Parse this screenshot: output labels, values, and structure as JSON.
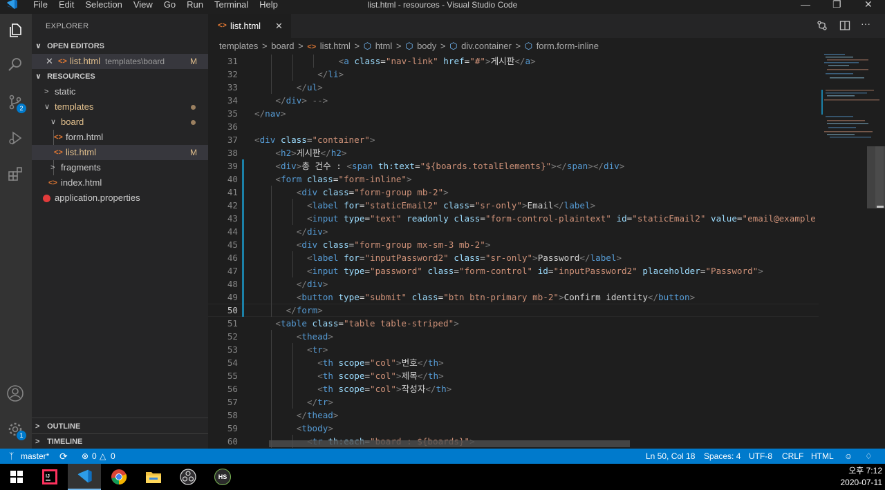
{
  "window": {
    "title": "list.html - resources - Visual Studio Code",
    "menu": [
      "File",
      "Edit",
      "Selection",
      "View",
      "Go",
      "Run",
      "Terminal",
      "Help"
    ]
  },
  "activity": {
    "source_control_badge": "2",
    "settings_badge": "1"
  },
  "sidebar": {
    "title": "EXPLORER",
    "open_editors_label": "OPEN EDITORS",
    "open_editor": {
      "name": "list.html",
      "path": "templates\\board",
      "status": "M"
    },
    "resources_label": "RESOURCES",
    "tree": [
      {
        "label": "static",
        "kind": "folder",
        "expanded": false
      },
      {
        "label": "templates",
        "kind": "folder",
        "expanded": true
      },
      {
        "label": "board",
        "kind": "folder",
        "expanded": true
      },
      {
        "label": "form.html",
        "kind": "html"
      },
      {
        "label": "list.html",
        "kind": "html",
        "status": "M"
      },
      {
        "label": "fragments",
        "kind": "folder",
        "expanded": false
      },
      {
        "label": "index.html",
        "kind": "html"
      },
      {
        "label": "application.properties",
        "kind": "properties"
      }
    ],
    "outline_label": "OUTLINE",
    "timeline_label": "TIMELINE"
  },
  "tab": {
    "label": "list.html"
  },
  "breadcrumb": [
    "templates",
    "board",
    "list.html",
    "html",
    "body",
    "div.container",
    "form.form-inline"
  ],
  "editor": {
    "lines": [
      {
        "n": "31",
        "indent": 16,
        "tokens": [
          [
            "p",
            "<"
          ],
          [
            "t",
            "a "
          ],
          [
            "a",
            "class"
          ],
          [
            "x",
            "="
          ],
          [
            "s",
            "\"nav-link\""
          ],
          [
            "x",
            " "
          ],
          [
            "a",
            "href"
          ],
          [
            "x",
            "="
          ],
          [
            "s",
            "\"#\""
          ],
          [
            "p",
            ">"
          ],
          [
            "x",
            "게시판"
          ],
          [
            "p",
            "</"
          ],
          [
            "t",
            "a"
          ],
          [
            "p",
            ">"
          ]
        ]
      },
      {
        "n": "32",
        "indent": 12,
        "tokens": [
          [
            "p",
            "</"
          ],
          [
            "t",
            "li"
          ],
          [
            "p",
            ">"
          ]
        ]
      },
      {
        "n": "33",
        "indent": 8,
        "tokens": [
          [
            "p",
            "</"
          ],
          [
            "t",
            "ul"
          ],
          [
            "p",
            ">"
          ]
        ]
      },
      {
        "n": "34",
        "indent": 4,
        "tokens": [
          [
            "p",
            "</"
          ],
          [
            "t",
            "div"
          ],
          [
            "p",
            ">"
          ],
          [
            "x",
            " "
          ],
          [
            "p",
            "-->"
          ]
        ]
      },
      {
        "n": "35",
        "indent": 0,
        "tokens": [
          [
            "p",
            "</"
          ],
          [
            "t",
            "nav"
          ],
          [
            "p",
            ">"
          ]
        ]
      },
      {
        "n": "36",
        "indent": 0,
        "tokens": []
      },
      {
        "n": "37",
        "indent": 0,
        "tokens": [
          [
            "p",
            "<"
          ],
          [
            "t",
            "div "
          ],
          [
            "a",
            "class"
          ],
          [
            "x",
            "="
          ],
          [
            "s",
            "\"container\""
          ],
          [
            "p",
            ">"
          ]
        ]
      },
      {
        "n": "38",
        "indent": 4,
        "tokens": [
          [
            "p",
            "<"
          ],
          [
            "t",
            "h2"
          ],
          [
            "p",
            ">"
          ],
          [
            "x",
            "게시판"
          ],
          [
            "p",
            "</"
          ],
          [
            "t",
            "h2"
          ],
          [
            "p",
            ">"
          ]
        ]
      },
      {
        "n": "39",
        "indent": 4,
        "mod": true,
        "tokens": [
          [
            "p",
            "<"
          ],
          [
            "t",
            "div"
          ],
          [
            "p",
            ">"
          ],
          [
            "x",
            "총 건수 : "
          ],
          [
            "p",
            "<"
          ],
          [
            "t",
            "span "
          ],
          [
            "a",
            "th:text"
          ],
          [
            "x",
            "="
          ],
          [
            "s",
            "\"${boards.totalElements}\""
          ],
          [
            "p",
            "></"
          ],
          [
            "t",
            "span"
          ],
          [
            "p",
            "></"
          ],
          [
            "t",
            "div"
          ],
          [
            "p",
            ">"
          ]
        ]
      },
      {
        "n": "40",
        "indent": 4,
        "mod": true,
        "tokens": [
          [
            "p",
            "<"
          ],
          [
            "t",
            "form "
          ],
          [
            "a",
            "class"
          ],
          [
            "x",
            "="
          ],
          [
            "s",
            "\"form-inline\""
          ],
          [
            "p",
            ">"
          ]
        ]
      },
      {
        "n": "41",
        "indent": 8,
        "mod": true,
        "tokens": [
          [
            "p",
            "<"
          ],
          [
            "t",
            "div "
          ],
          [
            "a",
            "class"
          ],
          [
            "x",
            "="
          ],
          [
            "s",
            "\"form-group mb-2\""
          ],
          [
            "p",
            ">"
          ]
        ]
      },
      {
        "n": "42",
        "indent": 10,
        "mod": true,
        "tokens": [
          [
            "p",
            "<"
          ],
          [
            "t",
            "label "
          ],
          [
            "a",
            "for"
          ],
          [
            "x",
            "="
          ],
          [
            "s",
            "\"staticEmail2\""
          ],
          [
            "x",
            " "
          ],
          [
            "a",
            "class"
          ],
          [
            "x",
            "="
          ],
          [
            "s",
            "\"sr-only\""
          ],
          [
            "p",
            ">"
          ],
          [
            "x",
            "Email"
          ],
          [
            "p",
            "</"
          ],
          [
            "t",
            "label"
          ],
          [
            "p",
            ">"
          ]
        ]
      },
      {
        "n": "43",
        "indent": 10,
        "mod": true,
        "tokens": [
          [
            "p",
            "<"
          ],
          [
            "t",
            "input "
          ],
          [
            "a",
            "type"
          ],
          [
            "x",
            "="
          ],
          [
            "s",
            "\"text\""
          ],
          [
            "x",
            " "
          ],
          [
            "a",
            "readonly"
          ],
          [
            "x",
            " "
          ],
          [
            "a",
            "class"
          ],
          [
            "x",
            "="
          ],
          [
            "s",
            "\"form-control-plaintext\""
          ],
          [
            "x",
            " "
          ],
          [
            "a",
            "id"
          ],
          [
            "x",
            "="
          ],
          [
            "s",
            "\"staticEmail2\""
          ],
          [
            "x",
            " "
          ],
          [
            "a",
            "value"
          ],
          [
            "x",
            "="
          ],
          [
            "s",
            "\"email@example"
          ]
        ]
      },
      {
        "n": "44",
        "indent": 8,
        "mod": true,
        "tokens": [
          [
            "p",
            "</"
          ],
          [
            "t",
            "div"
          ],
          [
            "p",
            ">"
          ]
        ]
      },
      {
        "n": "45",
        "indent": 8,
        "mod": true,
        "tokens": [
          [
            "p",
            "<"
          ],
          [
            "t",
            "div "
          ],
          [
            "a",
            "class"
          ],
          [
            "x",
            "="
          ],
          [
            "s",
            "\"form-group mx-sm-3 mb-2\""
          ],
          [
            "p",
            ">"
          ]
        ]
      },
      {
        "n": "46",
        "indent": 10,
        "mod": true,
        "tokens": [
          [
            "p",
            "<"
          ],
          [
            "t",
            "label "
          ],
          [
            "a",
            "for"
          ],
          [
            "x",
            "="
          ],
          [
            "s",
            "\"inputPassword2\""
          ],
          [
            "x",
            " "
          ],
          [
            "a",
            "class"
          ],
          [
            "x",
            "="
          ],
          [
            "s",
            "\"sr-only\""
          ],
          [
            "p",
            ">"
          ],
          [
            "x",
            "Password"
          ],
          [
            "p",
            "</"
          ],
          [
            "t",
            "label"
          ],
          [
            "p",
            ">"
          ]
        ]
      },
      {
        "n": "47",
        "indent": 10,
        "mod": true,
        "tokens": [
          [
            "p",
            "<"
          ],
          [
            "t",
            "input "
          ],
          [
            "a",
            "type"
          ],
          [
            "x",
            "="
          ],
          [
            "s",
            "\"password\""
          ],
          [
            "x",
            " "
          ],
          [
            "a",
            "class"
          ],
          [
            "x",
            "="
          ],
          [
            "s",
            "\"form-control\""
          ],
          [
            "x",
            " "
          ],
          [
            "a",
            "id"
          ],
          [
            "x",
            "="
          ],
          [
            "s",
            "\"inputPassword2\""
          ],
          [
            "x",
            " "
          ],
          [
            "a",
            "placeholder"
          ],
          [
            "x",
            "="
          ],
          [
            "s",
            "\"Password\""
          ],
          [
            "p",
            ">"
          ]
        ]
      },
      {
        "n": "48",
        "indent": 8,
        "mod": true,
        "tokens": [
          [
            "p",
            "</"
          ],
          [
            "t",
            "div"
          ],
          [
            "p",
            ">"
          ]
        ]
      },
      {
        "n": "49",
        "indent": 8,
        "mod": true,
        "tokens": [
          [
            "p",
            "<"
          ],
          [
            "t",
            "button "
          ],
          [
            "a",
            "type"
          ],
          [
            "x",
            "="
          ],
          [
            "s",
            "\"submit\""
          ],
          [
            "x",
            " "
          ],
          [
            "a",
            "class"
          ],
          [
            "x",
            "="
          ],
          [
            "s",
            "\"btn btn-primary mb-2\""
          ],
          [
            "p",
            ">"
          ],
          [
            "x",
            "Confirm identity"
          ],
          [
            "p",
            "</"
          ],
          [
            "t",
            "button"
          ],
          [
            "p",
            ">"
          ]
        ]
      },
      {
        "n": "50",
        "indent": 6,
        "mod": true,
        "current": true,
        "tokens": [
          [
            "p",
            "</"
          ],
          [
            "t",
            "form"
          ],
          [
            "p",
            ">"
          ]
        ]
      },
      {
        "n": "51",
        "indent": 4,
        "tokens": [
          [
            "p",
            "<"
          ],
          [
            "t",
            "table "
          ],
          [
            "a",
            "class"
          ],
          [
            "x",
            "="
          ],
          [
            "s",
            "\"table table-striped\""
          ],
          [
            "p",
            ">"
          ]
        ]
      },
      {
        "n": "52",
        "indent": 8,
        "tokens": [
          [
            "p",
            "<"
          ],
          [
            "t",
            "thead"
          ],
          [
            "p",
            ">"
          ]
        ]
      },
      {
        "n": "53",
        "indent": 10,
        "tokens": [
          [
            "p",
            "<"
          ],
          [
            "t",
            "tr"
          ],
          [
            "p",
            ">"
          ]
        ]
      },
      {
        "n": "54",
        "indent": 12,
        "tokens": [
          [
            "p",
            "<"
          ],
          [
            "t",
            "th "
          ],
          [
            "a",
            "scope"
          ],
          [
            "x",
            "="
          ],
          [
            "s",
            "\"col\""
          ],
          [
            "p",
            ">"
          ],
          [
            "x",
            "번호"
          ],
          [
            "p",
            "</"
          ],
          [
            "t",
            "th"
          ],
          [
            "p",
            ">"
          ]
        ]
      },
      {
        "n": "55",
        "indent": 12,
        "tokens": [
          [
            "p",
            "<"
          ],
          [
            "t",
            "th "
          ],
          [
            "a",
            "scope"
          ],
          [
            "x",
            "="
          ],
          [
            "s",
            "\"col\""
          ],
          [
            "p",
            ">"
          ],
          [
            "x",
            "제목"
          ],
          [
            "p",
            "</"
          ],
          [
            "t",
            "th"
          ],
          [
            "p",
            ">"
          ]
        ]
      },
      {
        "n": "56",
        "indent": 12,
        "tokens": [
          [
            "p",
            "<"
          ],
          [
            "t",
            "th "
          ],
          [
            "a",
            "scope"
          ],
          [
            "x",
            "="
          ],
          [
            "s",
            "\"col\""
          ],
          [
            "p",
            ">"
          ],
          [
            "x",
            "작성자"
          ],
          [
            "p",
            "</"
          ],
          [
            "t",
            "th"
          ],
          [
            "p",
            ">"
          ]
        ]
      },
      {
        "n": "57",
        "indent": 10,
        "tokens": [
          [
            "p",
            "</"
          ],
          [
            "t",
            "tr"
          ],
          [
            "p",
            ">"
          ]
        ]
      },
      {
        "n": "58",
        "indent": 8,
        "tokens": [
          [
            "p",
            "</"
          ],
          [
            "t",
            "thead"
          ],
          [
            "p",
            ">"
          ]
        ]
      },
      {
        "n": "59",
        "indent": 8,
        "tokens": [
          [
            "p",
            "<"
          ],
          [
            "t",
            "tbody"
          ],
          [
            "p",
            ">"
          ]
        ]
      },
      {
        "n": "60",
        "indent": 10,
        "tokens": [
          [
            "p",
            "<"
          ],
          [
            "t",
            "tr "
          ],
          [
            "a",
            "th:each"
          ],
          [
            "x",
            "="
          ],
          [
            "s",
            "\"board : ${boards}\""
          ],
          [
            "p",
            ">"
          ]
        ]
      }
    ]
  },
  "statusbar": {
    "branch": "master*",
    "errors": "0",
    "warnings": "0",
    "position": "Ln 50, Col 18",
    "spaces": "Spaces: 4",
    "encoding": "UTF-8",
    "eol": "CRLF",
    "language": "HTML"
  },
  "taskbar": {
    "time": "오후 7:12",
    "date": "2020-07-11",
    "hs_label": "HS"
  },
  "colors": {
    "accent": "#007acc",
    "tag": "#569cd6",
    "attr": "#9cdcfe",
    "string": "#ce9178",
    "modified": "#e2c08d"
  }
}
